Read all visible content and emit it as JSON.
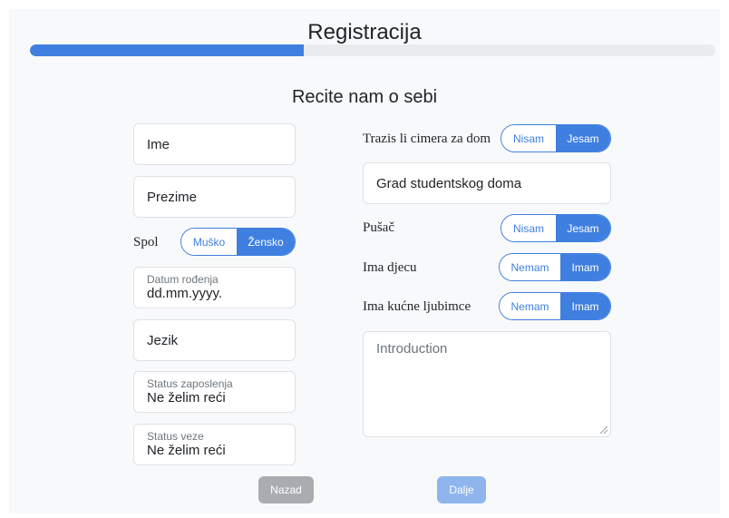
{
  "header": {
    "title": "Registracija",
    "progress_fraction": 0.4
  },
  "section": {
    "title": "Recite nam o sebi"
  },
  "left": {
    "first_name_placeholder": "Ime",
    "last_name_placeholder": "Prezime",
    "gender": {
      "label": "Spol",
      "options": [
        "Muško",
        "Žensko"
      ],
      "selected": "Žensko"
    },
    "dob": {
      "label": "Datum rođenja",
      "value": "dd.mm.yyyy."
    },
    "language_placeholder": "Jezik",
    "employment": {
      "label": "Status zaposlenja",
      "value": "Ne želim reći"
    },
    "relationship": {
      "label": "Status veze",
      "value": "Ne želim reći"
    }
  },
  "right": {
    "roommate": {
      "label": "Trazis li cimera za dom",
      "options": [
        "Nisam",
        "Jesam"
      ],
      "selected": "Jesam"
    },
    "dorm_city_placeholder": "Grad studentskog doma",
    "smoker": {
      "label": "Pušač",
      "options": [
        "Nisam",
        "Jesam"
      ],
      "selected": "Jesam"
    },
    "children": {
      "label": "Ima djecu",
      "options": [
        "Nemam",
        "Imam"
      ],
      "selected": "Imam"
    },
    "pets": {
      "label": "Ima kućne ljubimce",
      "options": [
        "Nemam",
        "Imam"
      ],
      "selected": "Imam"
    },
    "introduction_placeholder": "Introduction"
  },
  "footer": {
    "back_label": "Nazad",
    "next_label": "Dalje"
  },
  "colors": {
    "accent": "#3f7fe0",
    "back": "#a9adb2",
    "next_disabled": "#8fb5ee"
  }
}
